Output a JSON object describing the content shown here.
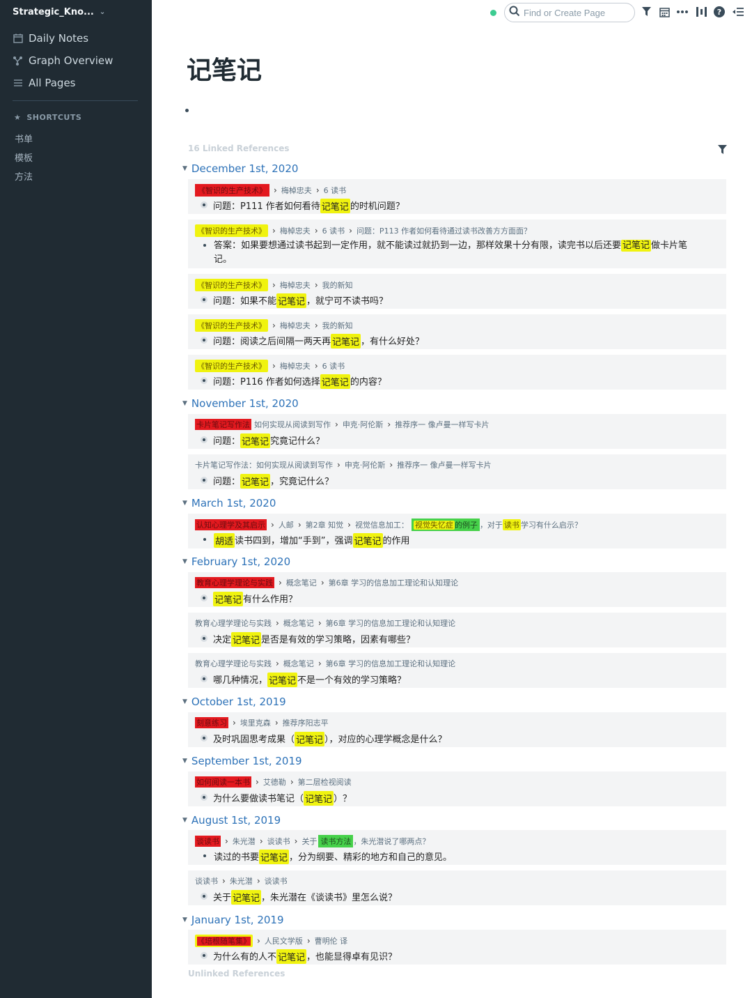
{
  "sidebar": {
    "graph_name": "Strategic_Kno...",
    "nav": [
      {
        "label": "Daily Notes",
        "icon": "calendar-icon"
      },
      {
        "label": "Graph Overview",
        "icon": "graph-icon"
      },
      {
        "label": "All Pages",
        "icon": "list-icon"
      }
    ],
    "shortcuts_title": "SHORTCUTS",
    "shortcuts": [
      "书单",
      "模板",
      "方法"
    ]
  },
  "topbar": {
    "search_placeholder": "Find or Create Page"
  },
  "page": {
    "title": "记笔记",
    "linked_title": "16 Linked References",
    "unlinked_title": "Unlinked References"
  },
  "groups": [
    {
      "date": "December 1st, 2020"
    },
    {
      "date": "November 1st, 2020"
    },
    {
      "date": "March 1st, 2020"
    },
    {
      "date": "February 1st, 2020"
    },
    {
      "date": "October 1st, 2019"
    },
    {
      "date": "September 1st, 2019"
    },
    {
      "date": "August 1st, 2019"
    },
    {
      "date": "January 1st, 2019"
    }
  ],
  "refs": [
    {
      "bc": [
        "《智识的生产技术》",
        "梅棹忠夫",
        "6 读书"
      ],
      "text": [
        "问题：P111 作者如何看待",
        "记笔记",
        "的时机问题？"
      ]
    },
    {
      "bc": [
        "《智识的生产技术》",
        "梅棹忠夫",
        "6 读书",
        "问题：P113 作者如何看待通过读书改善方方面面？"
      ],
      "text": [
        "答案：如果要想通过读书起到一定作用，就不能读过就扔到一边，那样效果十分有限，读完书以后还要",
        "记笔记",
        "做卡片笔记。"
      ]
    },
    {
      "bc": [
        "《智识的生产技术》",
        "梅棹忠夫",
        "我的新知"
      ],
      "text": [
        "问题：如果不能",
        "记笔记",
        "，就宁可不读书吗？"
      ]
    },
    {
      "bc": [
        "《智识的生产技术》",
        "梅棹忠夫",
        "我的新知"
      ],
      "text": [
        "问题：阅读之后间隔一两天再",
        "记笔记",
        "，有什么好处？"
      ]
    },
    {
      "bc": [
        "《智识的生产技术》",
        "梅棹忠夫",
        "6 读书"
      ],
      "text": [
        "问题：P116 作者如何选择",
        "记笔记",
        "的内容？"
      ]
    },
    {
      "bc": [
        "卡片笔记写作法",
        "如何实现从阅读到写作",
        "申克·阿伦斯",
        "推荐序一 像卢曼一样写卡片"
      ],
      "text": [
        "问题：",
        "记笔记",
        "究竟记什么？"
      ]
    },
    {
      "bc": [
        "卡片笔记写作法：如何实现从阅读到写作",
        "申克·阿伦斯",
        "推荐序一 像卢曼一样写卡片"
      ],
      "text": [
        "问题：",
        "记笔记",
        "，究竟记什么？"
      ]
    },
    {
      "bc": [
        "认知心理学及其启示",
        "人邮",
        "第2章 知觉",
        "视觉信息加工：",
        "视觉失忆症",
        "的例子",
        "，对于",
        "读书",
        "学习有什么启示？"
      ],
      "text": [
        "胡适",
        "读书四到，增加“手到”，强调",
        "记笔记",
        "的作用"
      ]
    },
    {
      "bc": [
        "教育心理学理论与实践",
        "概念笔记",
        "第6章 学习的信息加工理论和认知理论"
      ],
      "text": [
        "",
        "记笔记",
        "有什么作用？"
      ]
    },
    {
      "bc": [
        "教育心理学理论与实践",
        "概念笔记",
        "第6章 学习的信息加工理论和认知理论"
      ],
      "text": [
        "决定",
        "记笔记",
        "是否是有效的学习策略，因素有哪些？"
      ]
    },
    {
      "bc": [
        "教育心理学理论与实践",
        "概念笔记",
        "第6章 学习的信息加工理论和认知理论"
      ],
      "text": [
        "哪几种情况，",
        "记笔记",
        "不是一个有效的学习策略？"
      ]
    },
    {
      "bc": [
        "刻意练习",
        "埃里克森",
        "推荐序阳志平"
      ],
      "text": [
        "及时巩固思考成果（",
        "记笔记",
        "），对应的心理学概念是什么？"
      ]
    },
    {
      "bc": [
        "如何阅读一本书",
        "艾德勒",
        "第二层检视阅读"
      ],
      "text": [
        "为什么要做读书笔记（",
        "记笔记",
        "）？"
      ]
    },
    {
      "bc": [
        "谈读书",
        "朱光潜",
        "谈读书",
        "关于",
        "读书方法",
        "，朱光潜说了哪两点？"
      ],
      "text": [
        "读过的书要",
        "记笔记",
        "，分为纲要、精彩的地方和自己的意见。"
      ]
    },
    {
      "bc": [
        "谈读书",
        "朱光潜",
        "谈读书"
      ],
      "text": [
        "关于",
        "记笔记",
        "，朱光潜在《谈读书》里怎么说？"
      ]
    },
    {
      "bc": [
        "《培根随笔集》",
        "人民文学版",
        "曹明伦 译"
      ],
      "text": [
        "为什么有的人不",
        "记笔记",
        "，也能显得卓有见识？"
      ]
    }
  ],
  "colors": {
    "sidebar_bg": "#202b33",
    "link": "#2d72b8",
    "highlight_yellow": "#f0f30f",
    "highlight_red": "#e3191f",
    "highlight_green": "#46d14a",
    "status_dot": "#3dcc91"
  }
}
